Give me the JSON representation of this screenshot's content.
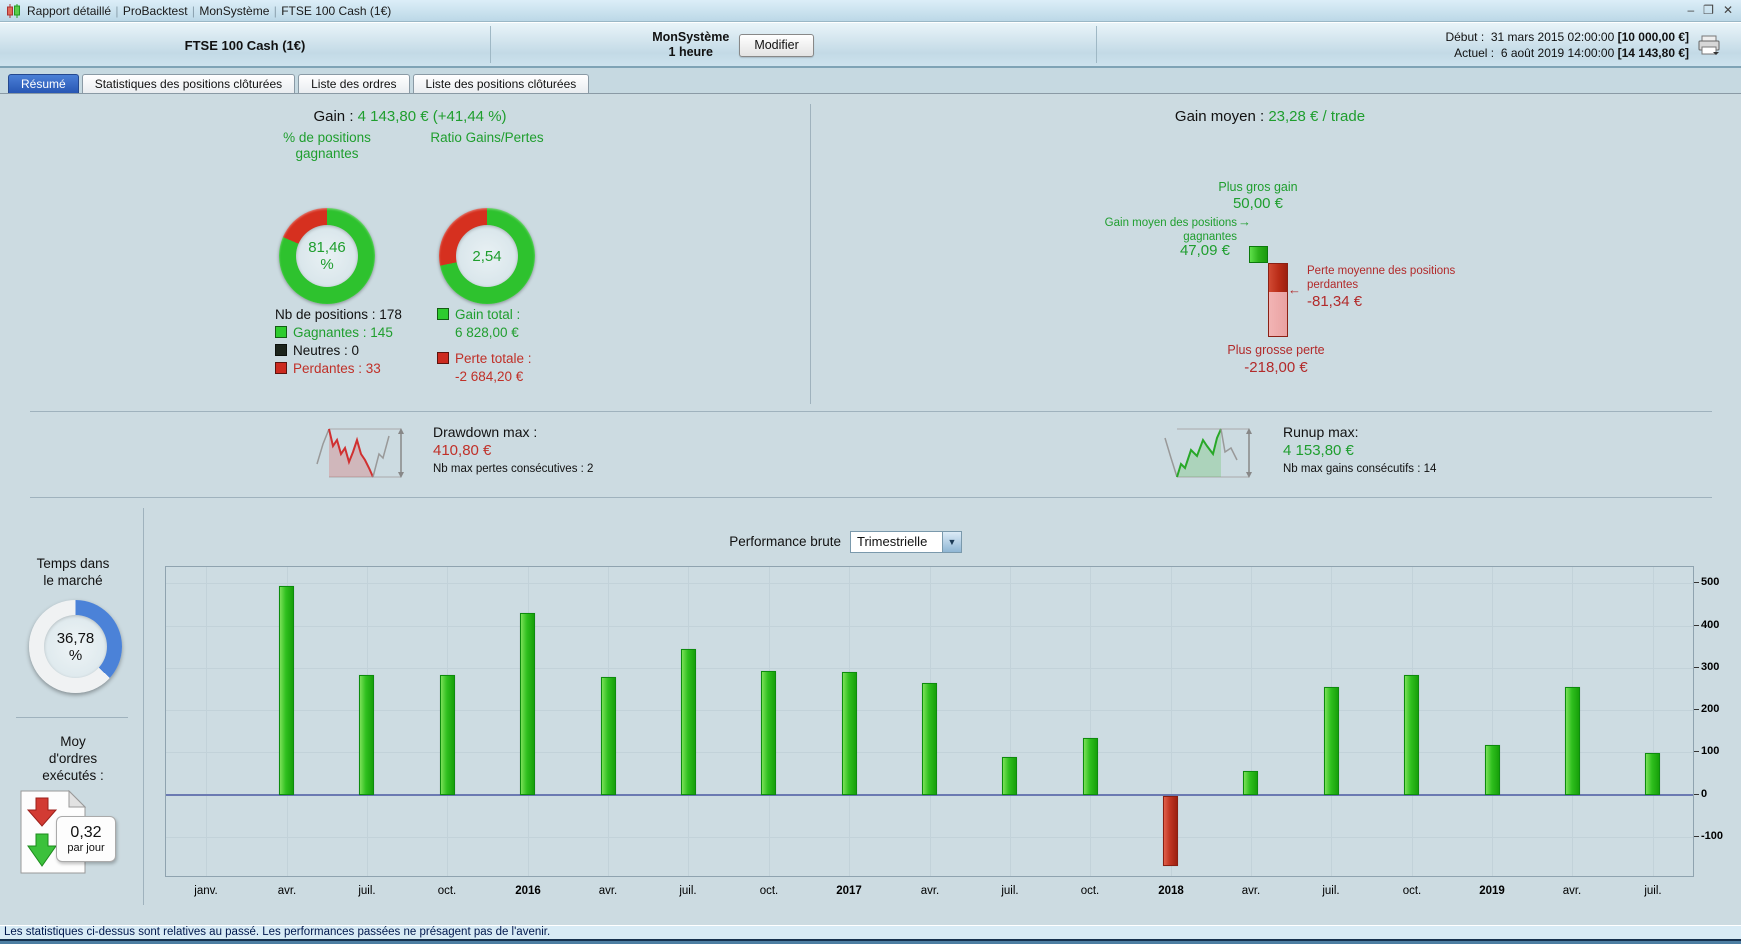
{
  "window": {
    "title_app": "Rapport détaillé",
    "title_parts": [
      "Rapport détaillé",
      "ProBacktest",
      "MonSystème",
      "FTSE 100 Cash (1€)"
    ],
    "controls": {
      "minimize": "–",
      "restore": "❐",
      "close": "✕"
    }
  },
  "header": {
    "instrument": "FTSE 100 Cash (1€)",
    "system_name": "MonSystème",
    "timeframe": "1 heure",
    "modify_button": "Modifier",
    "rows": [
      {
        "label": "Début :",
        "datetime": "31 mars 2015 02:00:00",
        "capital": "[10 000,00 €]"
      },
      {
        "label": "Actuel :",
        "datetime": "6 août 2019 14:00:00",
        "capital": "[14 143,80 €]"
      }
    ]
  },
  "tabs": [
    {
      "label": "Résumé",
      "active": true
    },
    {
      "label": "Statistiques des positions clôturées",
      "active": false
    },
    {
      "label": "Liste des ordres",
      "active": false
    },
    {
      "label": "Liste des positions clôturées",
      "active": false
    }
  ],
  "summary": {
    "gain_label": "Gain :",
    "gain_value": "4 143,80 € (+41,44 %)",
    "gain_moyen_label": "Gain moyen :",
    "gain_moyen_value": "23,28 € / trade",
    "winrate_donut": {
      "title": "% de positions gagnantes",
      "value_line1": "81,46",
      "value_line2": "%",
      "green_percent": 81.46
    },
    "ratio_donut": {
      "title": "Ratio Gains/Pertes",
      "value": "2,54",
      "green_percent": 71.75
    },
    "positions": {
      "total_label": "Nb de positions : 178",
      "items": [
        {
          "label": "Gagnantes : 145",
          "square": "#2ecc2e",
          "color": "#1f9e2e"
        },
        {
          "label": "Neutres : 0",
          "square": "#1c241c",
          "color": "#111111"
        },
        {
          "label": "Perdantes : 33",
          "square": "#cc2a1f",
          "color": "#c03028"
        }
      ]
    },
    "totals": [
      {
        "label": "Gain total :",
        "value": "6 828,00 €",
        "square": "#2ecc2e",
        "color": "#1f9e2e"
      },
      {
        "label": "Perte totale :",
        "value": "-2 684,20 €",
        "square": "#cc2a1f",
        "color": "#c03028"
      }
    ],
    "gainloss": {
      "biggest_gain_label": "Plus gros gain",
      "biggest_gain_value": "50,00 €",
      "biggest_gain_num": 50,
      "avg_win_label_line1": "Gain moyen des positions",
      "avg_win_label_line2": "gagnantes",
      "avg_win_arrow": "→",
      "avg_win_value": "47,09 €",
      "avg_loss_label_line1": "Perte moyenne des positions",
      "avg_loss_label_line2": "perdantes",
      "avg_loss_arrow": "←",
      "avg_loss_value": "-81,34 €",
      "avg_loss_num": 81.34,
      "biggest_loss_label": "Plus grosse perte",
      "biggest_loss_value": "-218,00 €",
      "biggest_loss_num": 218
    }
  },
  "drawdown": {
    "title": "Drawdown max :",
    "value": "410,80 €",
    "note": "Nb max pertes consécutives : 2"
  },
  "runup": {
    "title": "Runup max:",
    "value": "4 153,80 €",
    "note": "Nb max gains consécutifs : 14"
  },
  "left_stats": {
    "time_label_line1": "Temps dans",
    "time_label_line2": "le marché",
    "time_value_line1": "36,78",
    "time_value_line2": "%",
    "time_percent": 36.78,
    "orders_label_line1": "Moy",
    "orders_label_line2": "d'ordres",
    "orders_label_line3": "exécutés :",
    "orders_value": "0,32",
    "orders_unit": "par jour"
  },
  "chart_data": {
    "type": "bar",
    "title": "Performance brute",
    "period_selector_selected": "Trimestrielle",
    "categories": [
      "janv.",
      "avr.",
      "juil.",
      "oct.",
      "2016",
      "avr.",
      "juil.",
      "oct.",
      "2017",
      "avr.",
      "juil.",
      "oct.",
      "2018",
      "avr.",
      "juil.",
      "oct.",
      "2019",
      "avr.",
      "juil."
    ],
    "values": [
      null,
      495,
      285,
      285,
      430,
      280,
      345,
      293,
      291,
      266,
      89,
      136,
      -167,
      57,
      257,
      284,
      118,
      256,
      99
    ],
    "yticks": [
      500,
      400,
      300,
      200,
      100,
      0,
      -100
    ],
    "ylim": [
      -193,
      539
    ],
    "bold_categories": [
      "2016",
      "2017",
      "2018",
      "2019"
    ],
    "positive_color": "#2fc01e",
    "negative_color": "#c03522",
    "grid": true,
    "legend_position": "none",
    "xlabel": "",
    "ylabel": ""
  },
  "footer": {
    "disclaimer": "Les statistiques ci-dessus sont relatives au passé. Les performances passées ne présagent pas de l'avenir."
  },
  "colors": {
    "green": "#1f9e2e",
    "red": "#c03028",
    "blue": "#4b82d8"
  }
}
